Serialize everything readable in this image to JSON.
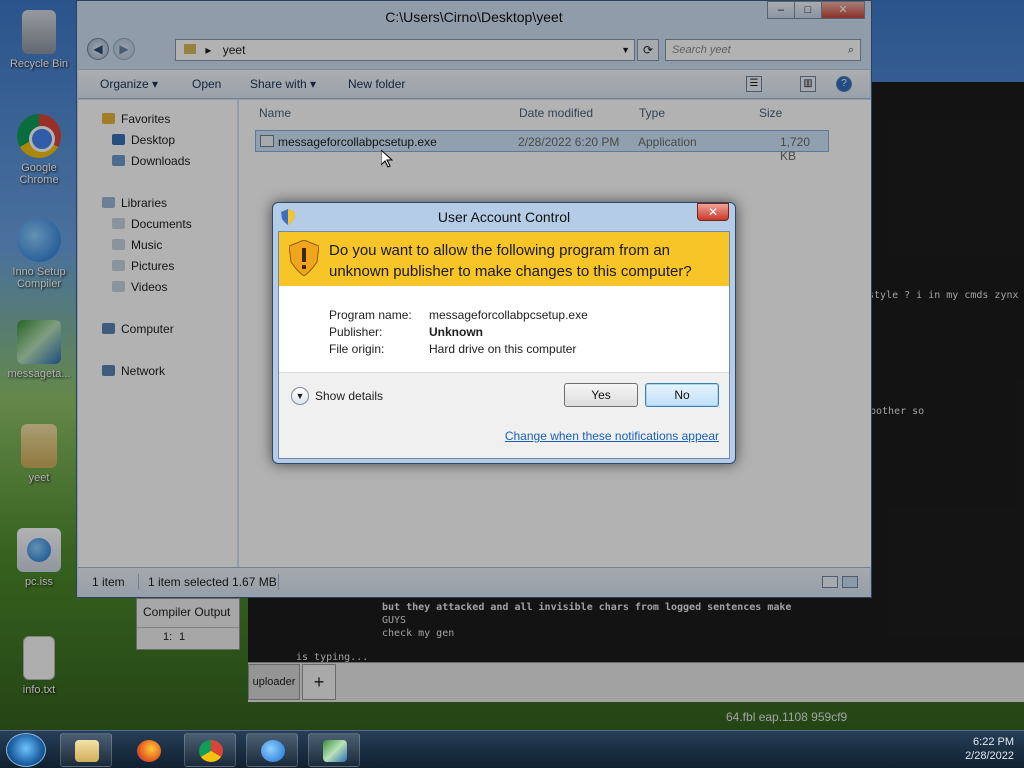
{
  "desktop": {
    "icons": [
      {
        "label": "Recycle Bin",
        "icon": "recycle-bin-icon"
      },
      {
        "label": "Google Chrome",
        "icon": "chrome-icon"
      },
      {
        "label": "Inno Setup Compiler",
        "icon": "inno-setup-icon"
      },
      {
        "label": "messageta...",
        "icon": "setup-file-icon"
      },
      {
        "label": "yeet",
        "icon": "folder-icon"
      },
      {
        "label": "pc.iss",
        "icon": "iss-file-icon"
      },
      {
        "label": "info.txt",
        "icon": "text-file-icon"
      }
    ]
  },
  "chat": {
    "lines": [
      {
        "text": "style ? i in my cmds zynx"
      },
      {
        "text": "bother so"
      },
      {
        "text": "but they attacked and all invisible chars from logged sentences make"
      },
      {
        "text": "GUYS"
      },
      {
        "text": "check my gen"
      },
      {
        "text": "is typing..."
      }
    ],
    "tab_label": "uploader",
    "plus_label": "+",
    "bottom_fragment": "64.fbl eap.1108 959cf9"
  },
  "compiler_panel": {
    "tab": "Compiler Output",
    "line_number": "1:",
    "value": "1"
  },
  "explorer": {
    "title": "C:\\Users\\Cirno\\Desktop\\yeet",
    "address": "yeet",
    "search_placeholder": "Search yeet",
    "toolbar": {
      "organize": "Organize ▾",
      "open": "Open",
      "share_with": "Share with ▾",
      "new_folder": "New folder"
    },
    "nav": {
      "favorites": "Favorites",
      "desktop": "Desktop",
      "downloads": "Downloads",
      "libraries": "Libraries",
      "documents": "Documents",
      "music": "Music",
      "pictures": "Pictures",
      "videos": "Videos",
      "computer": "Computer",
      "network": "Network"
    },
    "columns": {
      "name": "Name",
      "date": "Date modified",
      "type": "Type",
      "size": "Size"
    },
    "file": {
      "name": "messageforcollabpcsetup.exe",
      "date": "2/28/2022 6:20 PM",
      "type": "Application",
      "size": "1,720 KB"
    },
    "status": {
      "count": "1 item",
      "selected": "1 item selected  1.67 MB"
    }
  },
  "uac": {
    "title": "User Account Control",
    "question": "Do you want to allow the following program from an unknown publisher to make changes to this computer?",
    "fields": {
      "program_label": "Program name:",
      "program_value": "messageforcollabpcsetup.exe",
      "publisher_label": "Publisher:",
      "publisher_value": "Unknown",
      "origin_label": "File origin:",
      "origin_value": "Hard drive on this computer"
    },
    "show_details": "Show details",
    "yes": "Yes",
    "no": "No",
    "change_link": "Change when these notifications appear",
    "colors": {
      "banner": "#f7c528",
      "link": "#1a5fb4"
    }
  },
  "taskbar": {
    "apps": [
      "explorer-icon",
      "firefox-icon",
      "chrome-icon",
      "ie-icon",
      "inno-setup-icon"
    ],
    "clock_time": "6:22 PM",
    "clock_date": "2/28/2022"
  }
}
